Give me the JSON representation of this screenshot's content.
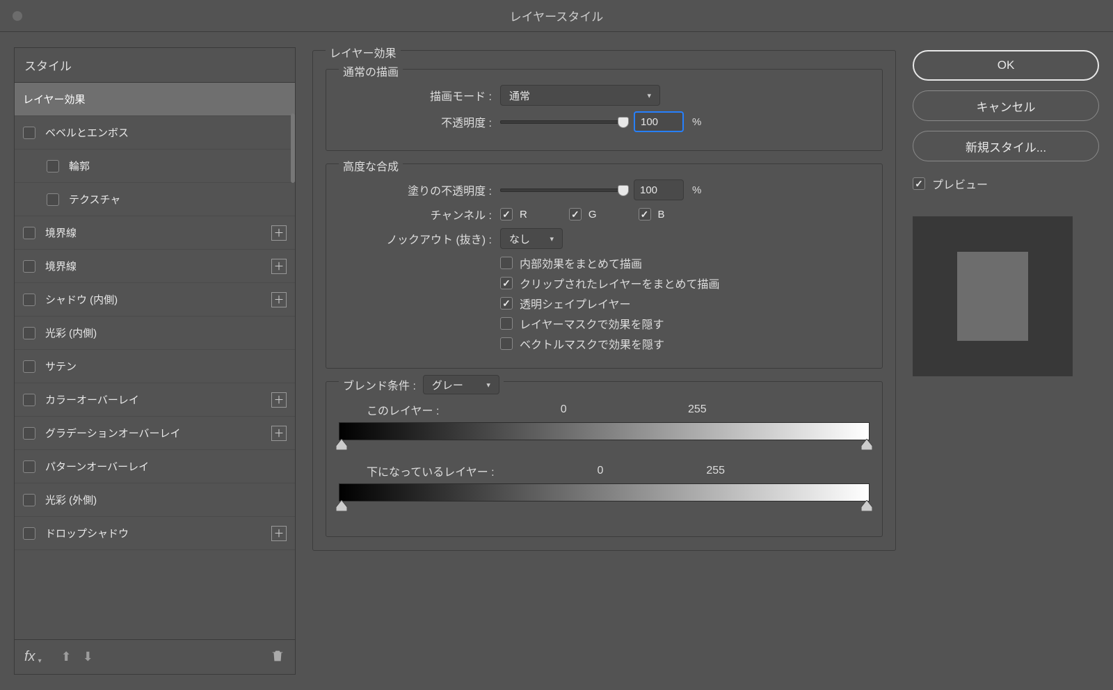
{
  "window": {
    "title": "レイヤースタイル"
  },
  "left": {
    "header": "スタイル",
    "selected": "レイヤー効果",
    "items": [
      {
        "label": "ベベルとエンボス",
        "plus": false
      },
      {
        "label": "輪郭",
        "sub": true
      },
      {
        "label": "テクスチャ",
        "sub": true
      },
      {
        "label": "境界線",
        "plus": true
      },
      {
        "label": "境界線",
        "plus": true
      },
      {
        "label": "シャドウ (内側)",
        "plus": true
      },
      {
        "label": "光彩 (内側)"
      },
      {
        "label": "サテン"
      },
      {
        "label": "カラーオーバーレイ",
        "plus": true
      },
      {
        "label": "グラデーションオーバーレイ",
        "plus": true
      },
      {
        "label": "パターンオーバーレイ"
      },
      {
        "label": "光彩 (外側)"
      },
      {
        "label": "ドロップシャドウ",
        "plus": true
      }
    ],
    "footer_fx": "fx"
  },
  "center": {
    "group_title": "レイヤー効果",
    "normal": {
      "legend": "通常の描画",
      "blend_mode_label": "描画モード :",
      "blend_mode_value": "通常",
      "opacity_label": "不透明度 :",
      "opacity_value": "100",
      "pct": "%"
    },
    "advanced": {
      "legend": "高度な合成",
      "fill_opacity_label": "塗りの不透明度 :",
      "fill_opacity_value": "100",
      "pct": "%",
      "channels_label": "チャンネル :",
      "ch_r": "R",
      "ch_g": "G",
      "ch_b": "B",
      "knockout_label": "ノックアウト (抜き) :",
      "knockout_value": "なし",
      "checks": [
        {
          "label": "内部効果をまとめて描画",
          "checked": false
        },
        {
          "label": "クリップされたレイヤーをまとめて描画",
          "checked": true
        },
        {
          "label": "透明シェイプレイヤー",
          "checked": true
        },
        {
          "label": "レイヤーマスクで効果を隠す",
          "checked": false
        },
        {
          "label": "ベクトルマスクで効果を隠す",
          "checked": false
        }
      ]
    },
    "blendif": {
      "legend": "ブレンド条件 :",
      "channel": "グレー",
      "this_layer_label": "このレイヤー :",
      "this_low": "0",
      "this_high": "255",
      "under_layer_label": "下になっているレイヤー :",
      "under_low": "0",
      "under_high": "255"
    }
  },
  "right": {
    "ok": "OK",
    "cancel": "キャンセル",
    "new_style": "新規スタイル...",
    "preview": "プレビュー"
  }
}
